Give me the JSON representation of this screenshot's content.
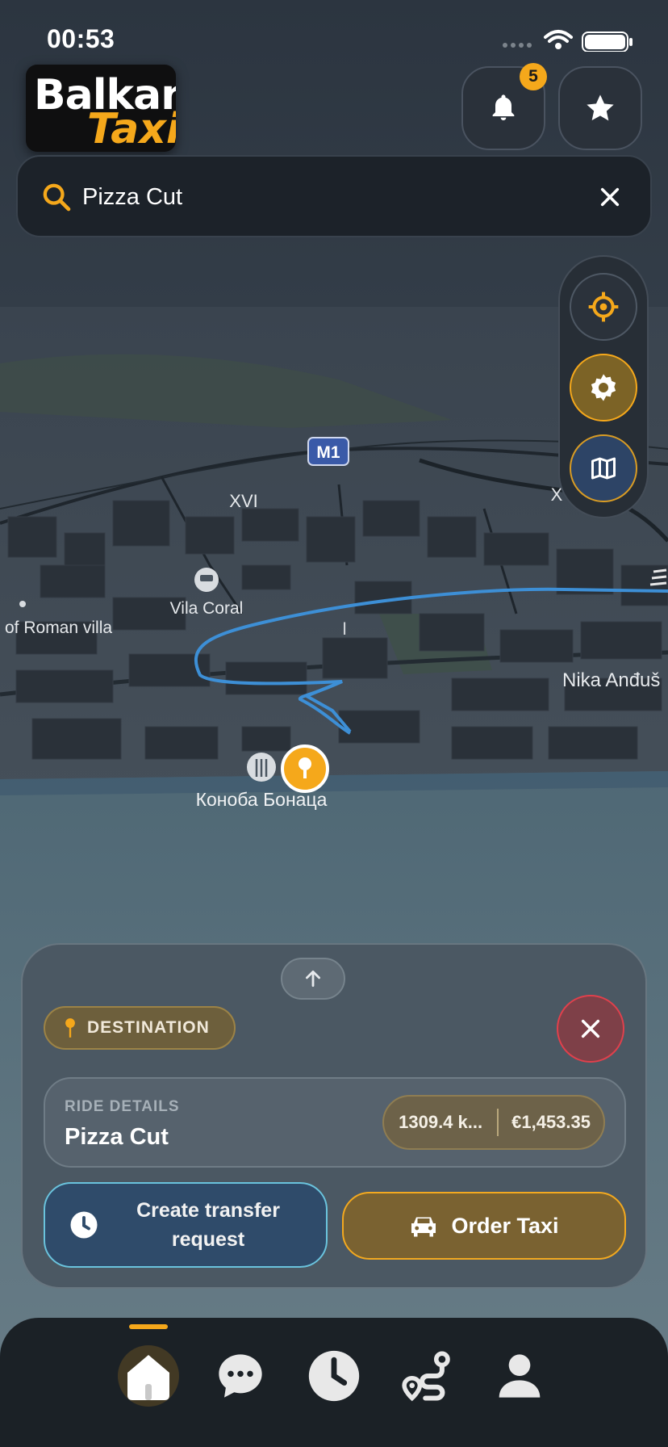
{
  "status_bar": {
    "time": "00:53"
  },
  "header": {
    "logo_line1": "Balkan",
    "logo_line2": "Taxi",
    "notifications_count": "5"
  },
  "search": {
    "value": "Pizza Cut"
  },
  "map": {
    "labels": {
      "m1": "M1",
      "xvi": "XVI",
      "x_partial": "X",
      "vila_coral": "Vila Coral",
      "roman_villa": "of Roman villa",
      "nika": "Nika Anđuš",
      "konoba": "Коноба Бонаца"
    }
  },
  "sheet": {
    "destination_label": "DESTINATION",
    "ride_details_label": "RIDE DETAILS",
    "ride_name": "Pizza Cut",
    "distance": "1309.4 k...",
    "price": "€1,453.35",
    "transfer_label": "Create transfer request",
    "order_label": "Order Taxi"
  },
  "colors": {
    "accent": "#f5a81b",
    "danger": "#e0404c",
    "route": "#3d8fd6",
    "transfer_border": "#6ac3dd"
  },
  "icons": {
    "header": [
      "bell-icon",
      "star-icon"
    ],
    "search": [
      "search-icon",
      "close-icon"
    ],
    "side": [
      "crosshair-icon",
      "gear-icon",
      "map-icon"
    ],
    "nav": [
      "home-icon",
      "chat-icon",
      "clock-icon",
      "route-icon",
      "user-icon"
    ]
  }
}
